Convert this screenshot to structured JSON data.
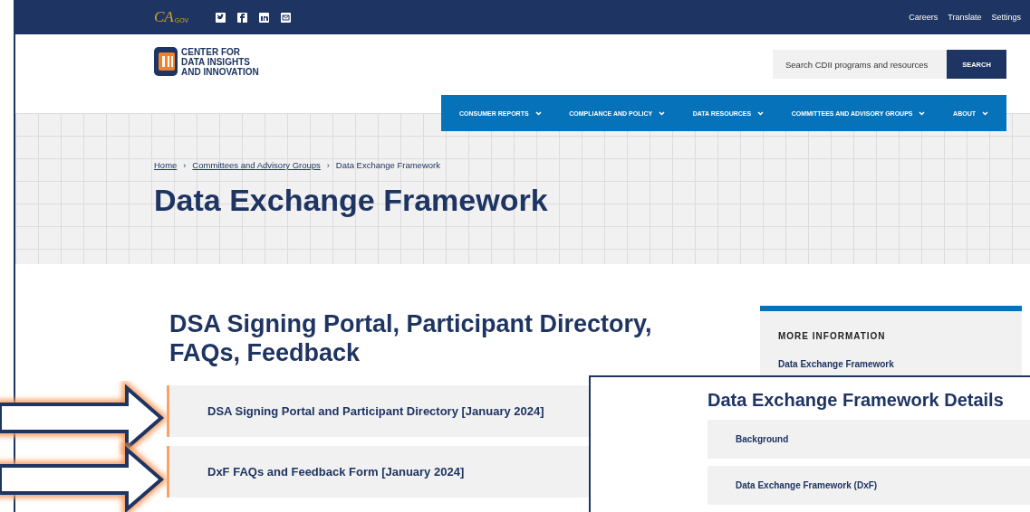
{
  "top_bar": {
    "logo": {
      "main": "CA",
      "sub": "GOV"
    },
    "social": [
      {
        "kind": "twitter"
      },
      {
        "kind": "facebook"
      },
      {
        "kind": "linkedin"
      },
      {
        "kind": "mail"
      }
    ],
    "links": [
      "Careers",
      "Translate",
      "Settings"
    ]
  },
  "header": {
    "org_name": [
      "CENTER FOR",
      "DATA INSIGHTS",
      "AND INNOVATION"
    ],
    "search": {
      "placeholder": "Search CDII programs and resources",
      "button": "SEARCH"
    }
  },
  "nav": [
    "CONSUMER REPORTS",
    "COMPLIANCE AND POLICY",
    "DATA RESOURCES",
    "COMMITTEES AND ADVISORY GROUPS",
    "ABOUT"
  ],
  "breadcrumb_separator": "›",
  "breadcrumb": [
    {
      "label": "Home",
      "link": true
    },
    {
      "label": "Committees and Advisory Groups",
      "link": true
    },
    {
      "label": "Data Exchange Framework",
      "link": false
    }
  ],
  "page_title": "Data Exchange Framework",
  "section": {
    "heading": "DSA Signing Portal, Participant Directory, FAQs, Feedback",
    "items": [
      {
        "label": "DSA Signing Portal and Participant Directory [January 2024]",
        "highlighted": true
      },
      {
        "label": "DxF FAQs and Feedback Form [January 2024]",
        "highlighted": true
      }
    ]
  },
  "sidebar": {
    "title": "MORE INFORMATION",
    "links": [
      "Data Exchange Framework"
    ]
  },
  "inset": {
    "heading": "Data Exchange Framework Details",
    "items": [
      "Background",
      "Data Exchange Framework (DxF)"
    ]
  }
}
